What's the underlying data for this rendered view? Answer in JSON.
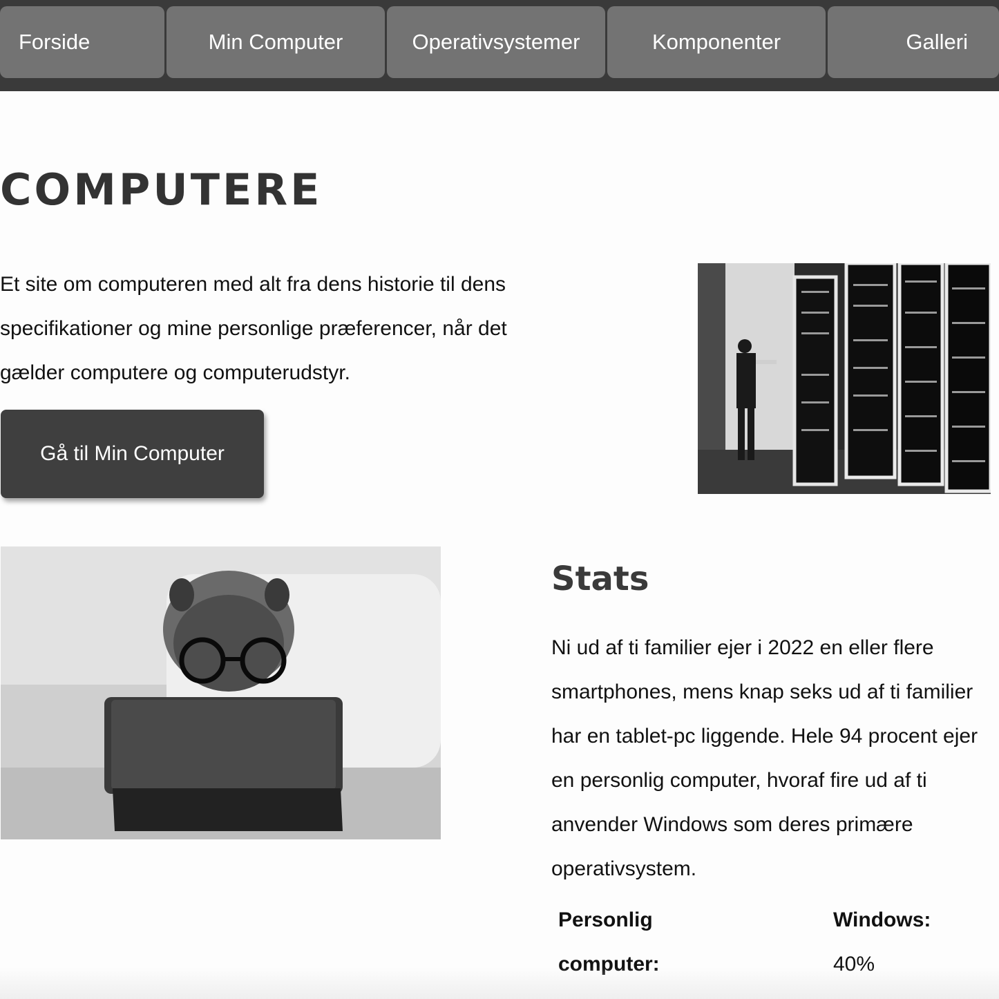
{
  "nav": {
    "items": [
      {
        "label": "Forside"
      },
      {
        "label": "Min Computer"
      },
      {
        "label": "Operativsystemer"
      },
      {
        "label": "Komponenter"
      },
      {
        "label": "Galleri"
      }
    ]
  },
  "hero": {
    "title": "COMPUTERE",
    "intro": "Et site om computeren med alt fra dens historie til dens specifikationer og mine personlige præferencer, når det gælder computere og computerudstyr.",
    "cta_label": "Gå til Min Computer"
  },
  "stats": {
    "title": "Stats",
    "text": "Ni ud af ti familier ejer i 2022 en eller flere smartphones, mens knap seks ud af ti familier har en tablet-pc liggende. Hele 94 procent ejer en personlig computer, hvoraf fire ud af ti anvender Windows som deres primære operativsystem.",
    "items": [
      {
        "label_line1": "Personlig",
        "label_line2": "computer:"
      },
      {
        "label": "Windows:",
        "value": "40%"
      }
    ]
  }
}
